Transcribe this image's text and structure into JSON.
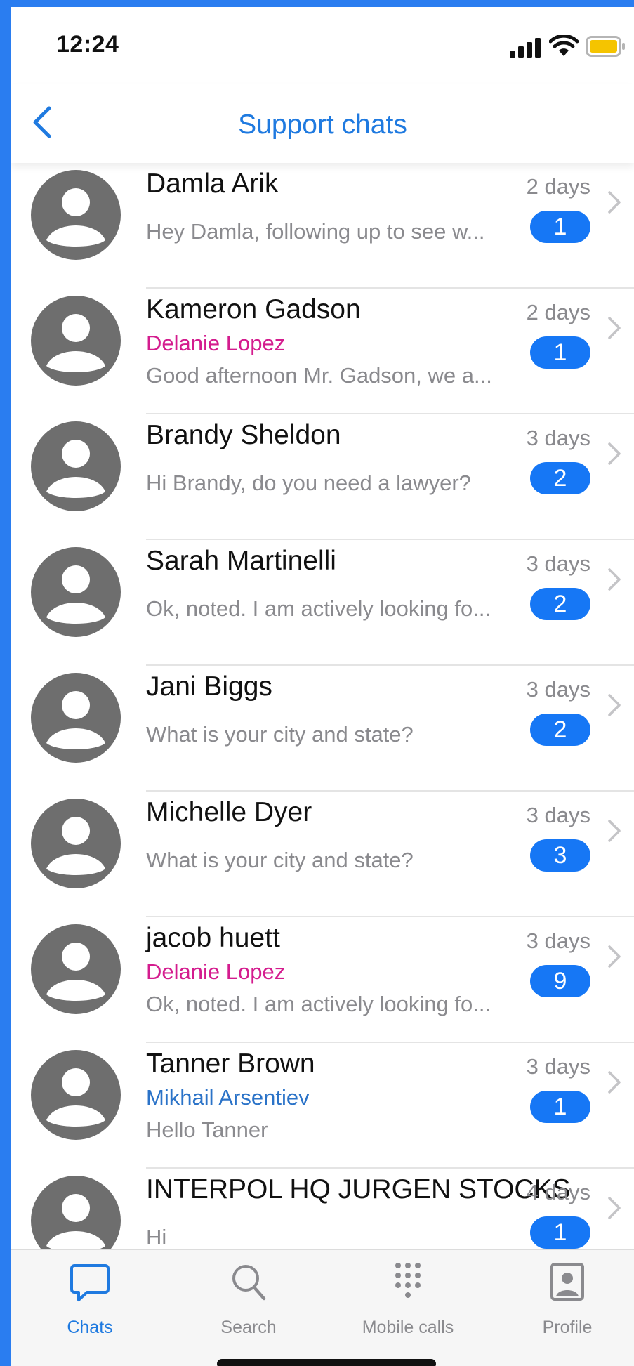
{
  "status_bar": {
    "time": "12:24"
  },
  "nav": {
    "title": "Support chats",
    "back_icon": "chevron-left-icon"
  },
  "colors": {
    "accent": "#1f7ae0",
    "badge": "#1677f5",
    "agent_pink": "#d41c8e",
    "agent_blue": "#2b73c8",
    "battery": "#f5c400",
    "frame": "#2a7df0"
  },
  "chats": [
    {
      "name": "Damla Arik",
      "agent": "",
      "agent_color": "",
      "preview": "Hey Damla, following up to see w...",
      "time": "2 days",
      "unread": "1"
    },
    {
      "name": "Kameron Gadson",
      "agent": "Delanie Lopez",
      "agent_color": "#d41c8e",
      "preview": "Good afternoon Mr. Gadson, we a...",
      "time": "2 days",
      "unread": "1"
    },
    {
      "name": "Brandy Sheldon",
      "agent": "",
      "agent_color": "",
      "preview": "Hi Brandy, do you need a lawyer?",
      "time": "3 days",
      "unread": "2"
    },
    {
      "name": "Sarah Martinelli",
      "agent": "",
      "agent_color": "",
      "preview": "Ok, noted. I am actively looking fo...",
      "time": "3 days",
      "unread": "2"
    },
    {
      "name": "Jani Biggs",
      "agent": "",
      "agent_color": "",
      "preview": "What is your city and state?",
      "time": "3 days",
      "unread": "2"
    },
    {
      "name": "Michelle Dyer",
      "agent": "",
      "agent_color": "",
      "preview": "What is your city and state?",
      "time": "3 days",
      "unread": "3"
    },
    {
      "name": "jacob huett",
      "agent": "Delanie Lopez",
      "agent_color": "#d41c8e",
      "preview": "Ok, noted. I am actively looking fo...",
      "time": "3 days",
      "unread": "9"
    },
    {
      "name": "Tanner Brown",
      "agent": "Mikhail Arsentiev",
      "agent_color": "#2b73c8",
      "preview": "Hello Tanner",
      "time": "3 days",
      "unread": "1"
    },
    {
      "name": "INTERPOL HQ JURGEN STOCKS",
      "agent": "",
      "agent_color": "",
      "preview": "Hi",
      "time": "4 days",
      "unread": "1"
    }
  ],
  "tabs": [
    {
      "label": "Chats",
      "icon": "chat-bubble-icon",
      "active": true
    },
    {
      "label": "Search",
      "icon": "search-icon",
      "active": false
    },
    {
      "label": "Mobile calls",
      "icon": "dialpad-icon",
      "active": false
    },
    {
      "label": "Profile",
      "icon": "profile-icon",
      "active": false
    }
  ]
}
